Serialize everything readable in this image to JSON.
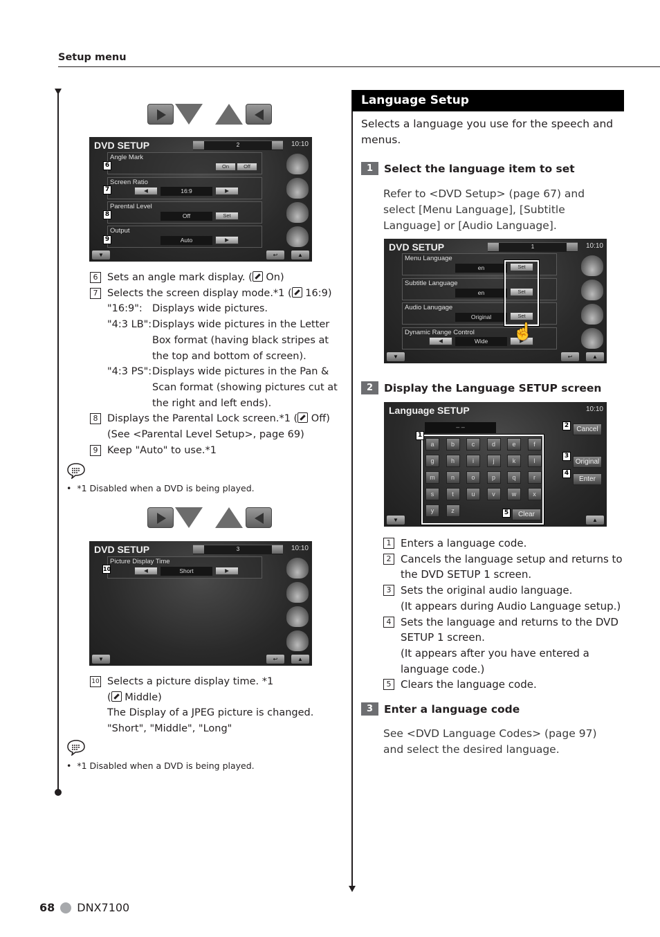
{
  "header": {
    "section_title": "Setup menu"
  },
  "left": {
    "screen2": {
      "title": "DVD SETUP",
      "page": "2",
      "time": "10:10",
      "rows": [
        {
          "callout": "6",
          "label": "Angle Mark",
          "on_label": "On",
          "off_label": "Off"
        },
        {
          "callout": "7",
          "label": "Screen Ratio",
          "value": "16:9"
        },
        {
          "callout": "8",
          "label": "Parental Level",
          "value": "Off",
          "button": "Set"
        },
        {
          "callout": "9",
          "label": "Output",
          "value": "Auto"
        }
      ]
    },
    "items_a": [
      {
        "num": "6",
        "text": "Sets an angle mark display. (",
        "default": "On)"
      },
      {
        "num": "7",
        "text": "Selects the screen display mode.*1 (",
        "default": "16:9)"
      },
      {
        "key": "\"16:9\":",
        "val": "Displays wide pictures."
      },
      {
        "key": "\"4:3 LB\":",
        "val": "Displays wide pictures in the Letter Box format (having black stripes at the top and bottom of screen)."
      },
      {
        "key": "\"4:3 PS\":",
        "val": "Displays wide pictures in the Pan & Scan format (showing pictures cut at the right and left ends)."
      },
      {
        "num": "8",
        "text": "Displays the Parental Lock screen.*1 (",
        "default": "Off)",
        "extra": "(See <Parental Level Setup>, page 69)"
      },
      {
        "num": "9",
        "text": "Keep \"Auto\" to use.*1"
      }
    ],
    "footnote_a": "*1 Disabled when a DVD is being played.",
    "screen3": {
      "title": "DVD SETUP",
      "page": "3",
      "time": "10:10",
      "row": {
        "callout": "10",
        "label": "Picture Display Time",
        "value": "Short"
      }
    },
    "items_b": {
      "num": "10",
      "text": "Selects a picture display time. *1",
      "default": "Middle)",
      "line3": "The Display of a JPEG picture is changed.",
      "line4": "\"Short\", \"Middle\", \"Long\""
    },
    "footnote_b": "*1 Disabled when a DVD is being played."
  },
  "right": {
    "section_title": "Language Setup",
    "intro": "Selects a language you use for the speech and menus.",
    "step1": {
      "num": "1",
      "title": "Select the language item to set",
      "body": "Refer to <DVD Setup> (page 67) and select [Menu Language], [Subtitle Language] or [Audio Language]."
    },
    "screen1": {
      "title": "DVD SETUP",
      "page": "1",
      "time": "10:10",
      "rows": [
        {
          "label": "Menu Language",
          "value": "en",
          "button": "Set"
        },
        {
          "label": "Subtitle Language",
          "value": "en",
          "button": "Set"
        },
        {
          "label": "Audio Lanugage",
          "value": "Original",
          "button": "Set"
        },
        {
          "label": "Dynamic Range Control",
          "value": "Wide"
        }
      ]
    },
    "step2": {
      "num": "2",
      "title": "Display the Language SETUP screen"
    },
    "lang_screen": {
      "title": "Language SETUP",
      "time": "10:10",
      "code_display": "– –",
      "keys": [
        "a",
        "b",
        "c",
        "d",
        "e",
        "f",
        "g",
        "h",
        "i",
        "j",
        "k",
        "l",
        "m",
        "n",
        "o",
        "p",
        "q",
        "r",
        "s",
        "t",
        "u",
        "v",
        "w",
        "x",
        "y",
        "z"
      ],
      "cancel": "Cancel",
      "original": "Original",
      "enter": "Enter",
      "clear": "Clear",
      "callouts": [
        "1",
        "2",
        "3",
        "4",
        "5"
      ]
    },
    "items": [
      {
        "num": "1",
        "lines": [
          "Enters a language code."
        ]
      },
      {
        "num": "2",
        "lines": [
          "Cancels the language setup and returns to",
          "the DVD SETUP 1 screen."
        ]
      },
      {
        "num": "3",
        "lines": [
          "Sets the original audio language.",
          "(It appears during Audio Language setup.)"
        ]
      },
      {
        "num": "4",
        "lines": [
          "Sets the language and returns to the DVD",
          "SETUP 1 screen.",
          "(It appears after you have entered a",
          "language code.)"
        ]
      },
      {
        "num": "5",
        "lines": [
          "Clears the language code."
        ]
      }
    ],
    "step3": {
      "num": "3",
      "title": "Enter a language code",
      "body": "See <DVD Language Codes> (page 97) and select the desired language."
    }
  },
  "footer": {
    "page": "68",
    "model": "DNX7100"
  }
}
